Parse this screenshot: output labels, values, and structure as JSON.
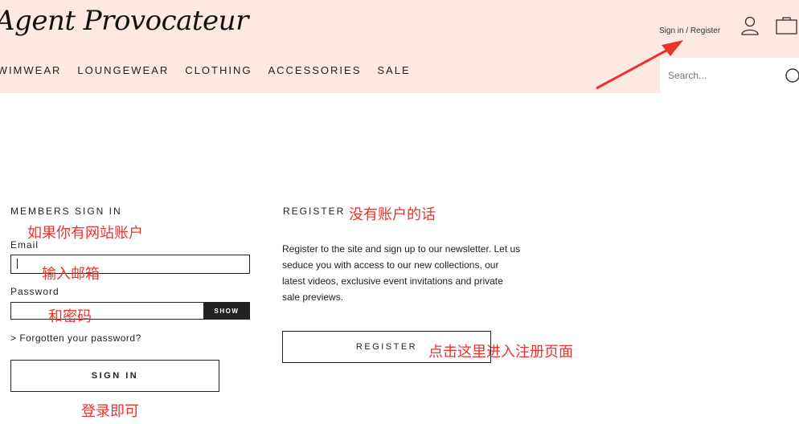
{
  "header": {
    "logo_text": "Agent Provocateur",
    "nav": [
      "SWIMWEAR",
      "LOUNGEWEAR",
      "CLOTHING",
      "ACCESSORIES",
      "SALE"
    ],
    "account_link": "Sign in / Register",
    "search_placeholder": "Search..."
  },
  "members": {
    "title": "MEMBERS SIGN IN",
    "email_label": "Email",
    "password_label": "Password",
    "show_label": "SHOW",
    "forgot_label": "> Forgotten your password?",
    "sign_in_label": "SIGN IN"
  },
  "register": {
    "title": "REGISTER",
    "text_lines": [
      "Register to the site and sign up to our newsletter. Let us",
      "seduce you with access to our new collections, our",
      "latest videos, exclusive event invitations and private",
      "sale previews."
    ],
    "button_label": "REGISTER"
  },
  "annotations": {
    "no_account": "没有账户的话",
    "has_account": "如果你有网站账户",
    "enter_email": "输入邮箱",
    "and_password": "和密码",
    "click_register": "点击这里进入注册页面",
    "login_done": "登录即可",
    "color": "#e8332e"
  },
  "icons": {
    "user": "user-icon",
    "bag": "shopping-bag-icon",
    "search": "search-icon"
  }
}
